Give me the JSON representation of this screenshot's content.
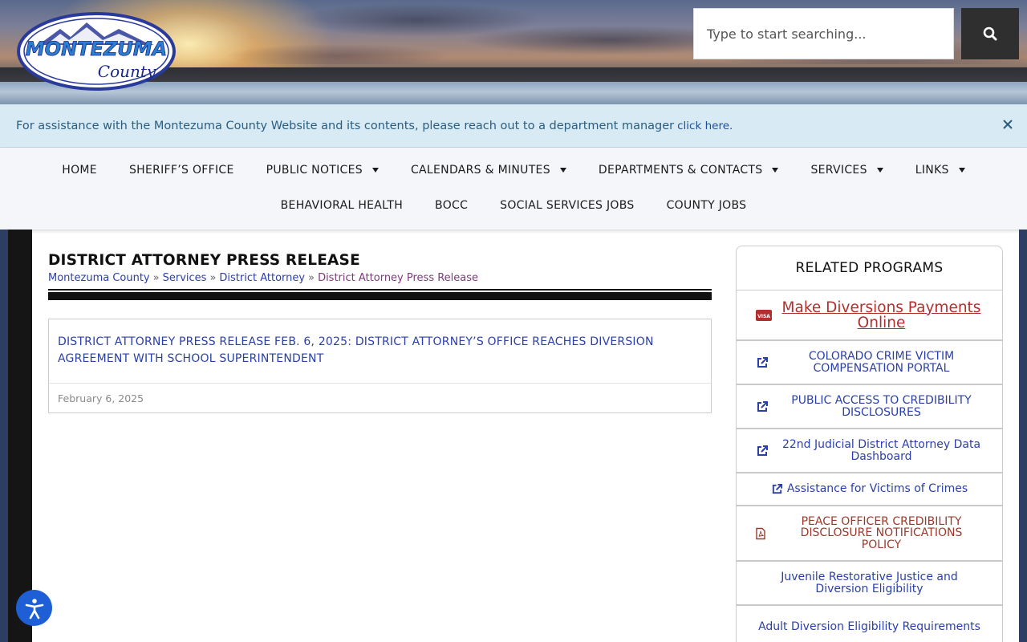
{
  "header": {
    "logo": {
      "line1": "MONTEZUMA",
      "line2": "County",
      "icon": "county-logo"
    },
    "search": {
      "placeholder": "Type to start searching...",
      "icon": "search-icon"
    }
  },
  "notice": {
    "text": "For assistance with the Montezuma County Website and its contents, please reach out to a department manager",
    "link_text": "click here.",
    "close_icon": "close-icon"
  },
  "nav": {
    "row1": [
      {
        "label": "HOME",
        "dropdown": false
      },
      {
        "label": "SHERIFF’S OFFICE",
        "dropdown": false
      },
      {
        "label": "PUBLIC NOTICES",
        "dropdown": true
      },
      {
        "label": "CALENDARS & MINUTES",
        "dropdown": true
      },
      {
        "label": "DEPARTMENTS & CONTACTS",
        "dropdown": true
      },
      {
        "label": "SERVICES",
        "dropdown": true
      },
      {
        "label": "LINKS",
        "dropdown": true
      }
    ],
    "row2": [
      {
        "label": "BEHAVIORAL HEALTH"
      },
      {
        "label": "BOCC"
      },
      {
        "label": "SOCIAL SERVICES JOBS"
      },
      {
        "label": "COUNTY JOBS"
      }
    ]
  },
  "main": {
    "title": "DISTRICT ATTORNEY PRESS RELEASE",
    "breadcrumb": {
      "items": [
        "Montezuma County",
        "Services",
        "District Attorney"
      ],
      "separator": "»",
      "current": "District Attorney Press Release"
    },
    "article": {
      "title": "DISTRICT ATTORNEY PRESS RELEASE FEB. 6, 2025: DISTRICT ATTORNEY’S OFFICE REACHES DIVERSION AGREEMENT WITH SCHOOL SUPERINTENDENT",
      "date": "February 6, 2025"
    }
  },
  "sidebar": {
    "heading": "RELATED PROGRAMS",
    "programs": [
      {
        "label": "Make Diversions Payments Online",
        "icon": "visa-card-icon"
      },
      {
        "label": "COLORADO CRIME VICTIM COMPENSATION PORTAL",
        "icon": "external-link-icon"
      },
      {
        "label": "PUBLIC ACCESS TO CREDIBILITY DISCLOSURES",
        "icon": "external-link-icon"
      },
      {
        "label": "22nd Judicial District Attorney Data Dashboard",
        "icon": "external-link-icon"
      },
      {
        "label": "Assistance for Victims of Crimes",
        "icon": "external-link-icon"
      },
      {
        "label": "PEACE OFFICER CREDIBILITY DISCLOSURE NOTIFICATIONS POLICY",
        "icon": "pdf-file-icon"
      },
      {
        "label": "Juvenile Restorative Justice and Diversion Eligibility",
        "icon": ""
      },
      {
        "label": "Adult Diversion Eligibility Requirements",
        "icon": ""
      }
    ]
  },
  "accessibility": {
    "icon": "accessibility-icon"
  },
  "colors": {
    "link_blue": "#2b3fa8",
    "notice_bg": "#d8ebf4",
    "pay_red": "#b03030",
    "pdf_red": "#9a3a2a",
    "a11y_blue": "#1f5fd6",
    "sidebar_navy": "#2e3e63"
  }
}
